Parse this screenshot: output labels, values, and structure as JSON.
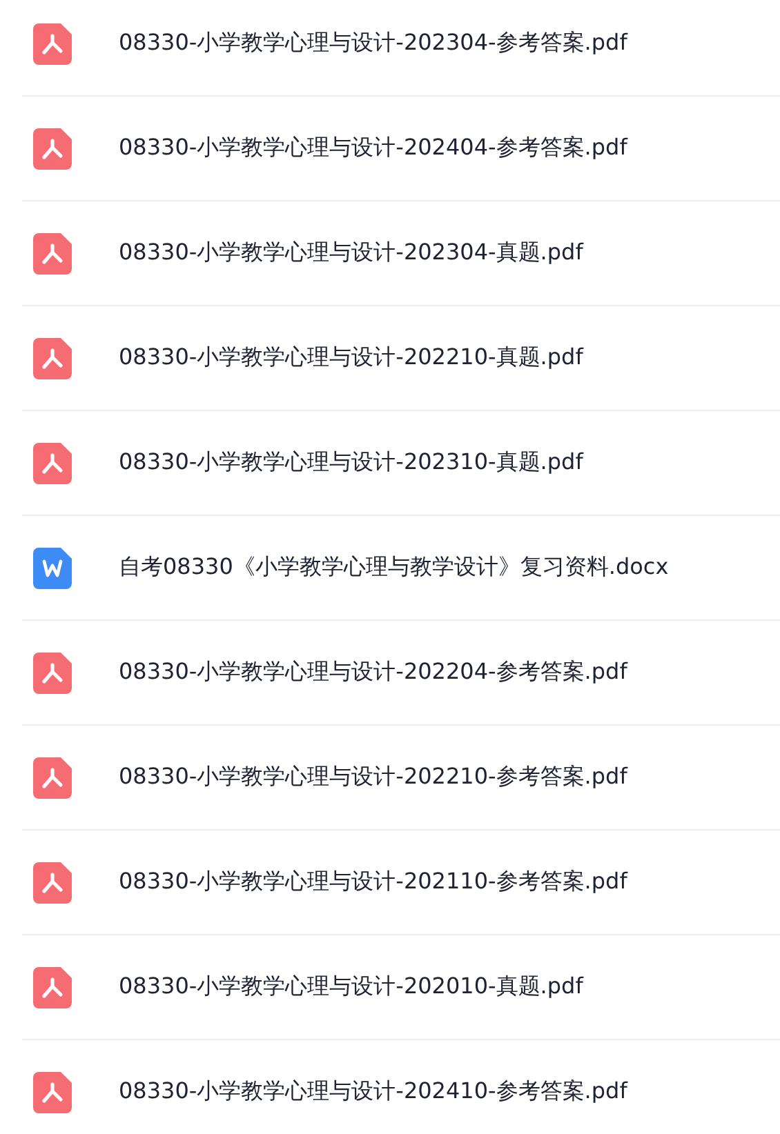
{
  "files": [
    {
      "kind": "pdf",
      "name": "08330-小学教学心理与设计-202304-参考答案.pdf"
    },
    {
      "kind": "pdf",
      "name": "08330-小学教学心理与设计-202404-参考答案.pdf"
    },
    {
      "kind": "pdf",
      "name": "08330-小学教学心理与设计-202304-真题.pdf"
    },
    {
      "kind": "pdf",
      "name": "08330-小学教学心理与设计-202210-真题.pdf"
    },
    {
      "kind": "pdf",
      "name": "08330-小学教学心理与设计-202310-真题.pdf"
    },
    {
      "kind": "docx",
      "name": "自考08330《小学教学心理与教学设计》复习资料.docx"
    },
    {
      "kind": "pdf",
      "name": "08330-小学教学心理与设计-202204-参考答案.pdf"
    },
    {
      "kind": "pdf",
      "name": "08330-小学教学心理与设计-202210-参考答案.pdf"
    },
    {
      "kind": "pdf",
      "name": "08330-小学教学心理与设计-202110-参考答案.pdf"
    },
    {
      "kind": "pdf",
      "name": "08330-小学教学心理与设计-202010-真题.pdf"
    },
    {
      "kind": "pdf",
      "name": "08330-小学教学心理与设计-202410-参考答案.pdf"
    }
  ]
}
